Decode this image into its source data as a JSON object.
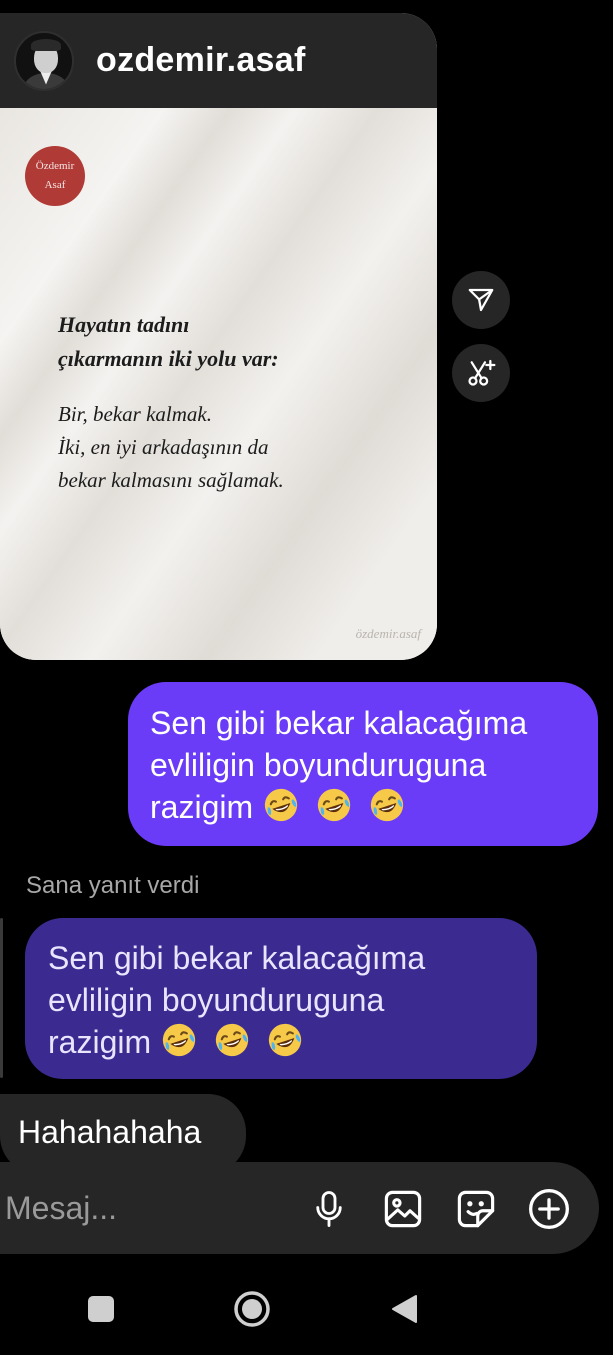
{
  "post": {
    "username": "ozdemir.asaf",
    "badge_line1": "Özdemir",
    "badge_line2": "Asaf",
    "quote_title_line1": "Hayatın tadını",
    "quote_title_line2": "çıkarmanın iki yolu var:",
    "quote_body_line1": "Bir, bekar kalmak.",
    "quote_body_line2": "İki, en iyi arkadaşının da",
    "quote_body_line3": "bekar kalmasını sağlamak.",
    "watermark": "özdemir.asaf"
  },
  "side_actions": {
    "share_icon": "send-icon",
    "remix_icon": "scissors-sparkle-icon"
  },
  "messages": {
    "sent": {
      "line1": "Sen gibi bekar kalacağıma",
      "line2": "evliligin boyunduruguna",
      "line3": "razigim"
    },
    "reply_label": "Sana yanıt verdi",
    "quoted": {
      "line1": "Sen gibi bekar kalacağıma",
      "line2": "evliligin boyunduruguna",
      "line3": "razigim"
    },
    "received": "Hahahahaha",
    "emoji_name": "rolling-on-floor-laughing"
  },
  "composer": {
    "placeholder": "Mesaj..."
  },
  "navbar": {
    "recents": "square-icon",
    "home": "circle-icon",
    "back": "triangle-back-icon"
  },
  "colors": {
    "sent_bubble": "#6b3cf7",
    "quoted_bubble": "#3b2b90",
    "received_bubble": "#262626",
    "badge": "#b03a36"
  }
}
